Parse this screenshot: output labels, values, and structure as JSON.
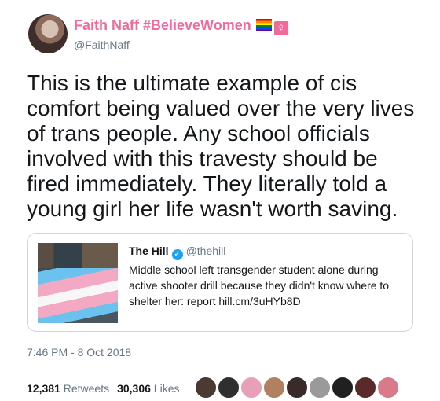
{
  "author": {
    "name": "Faith Naff #BelieveWomen",
    "handle": "@FaithNaff",
    "emoji": [
      "rainbow-flag",
      "female-sign"
    ],
    "venus_glyph": "♀"
  },
  "tweet": {
    "text": "This is the ultimate example of cis comfort being valued over the very lives of trans people. Any school officials involved with this travesty should be fired immediately. They literally told a young girl her life wasn't worth saving."
  },
  "quote": {
    "name": "The Hill",
    "verified_glyph": "✓",
    "handle": "@thehill",
    "text": "Middle school left transgender student alone during active shooter drill because they didn't know where to shelter her: report hill.cm/3uHYb8D"
  },
  "timestamp": "7:46 PM - 8 Oct 2018",
  "stats": {
    "retweets_count": "12,381",
    "retweets_label": "Retweets",
    "likes_count": "30,306",
    "likes_label": "Likes"
  },
  "likers": [
    {
      "color": "#4a3a32"
    },
    {
      "color": "#2f2f2f"
    },
    {
      "color": "#e8a0b8"
    },
    {
      "color": "#b08060"
    },
    {
      "color": "#3a2a2a"
    },
    {
      "color": "#9a9a9a"
    },
    {
      "color": "#202020"
    },
    {
      "color": "#5a2a2a"
    },
    {
      "color": "#d87a8a"
    }
  ],
  "colors": {
    "accent_pink": "#f06a9c",
    "verified_blue": "#1da1f2",
    "muted": "#657786"
  }
}
